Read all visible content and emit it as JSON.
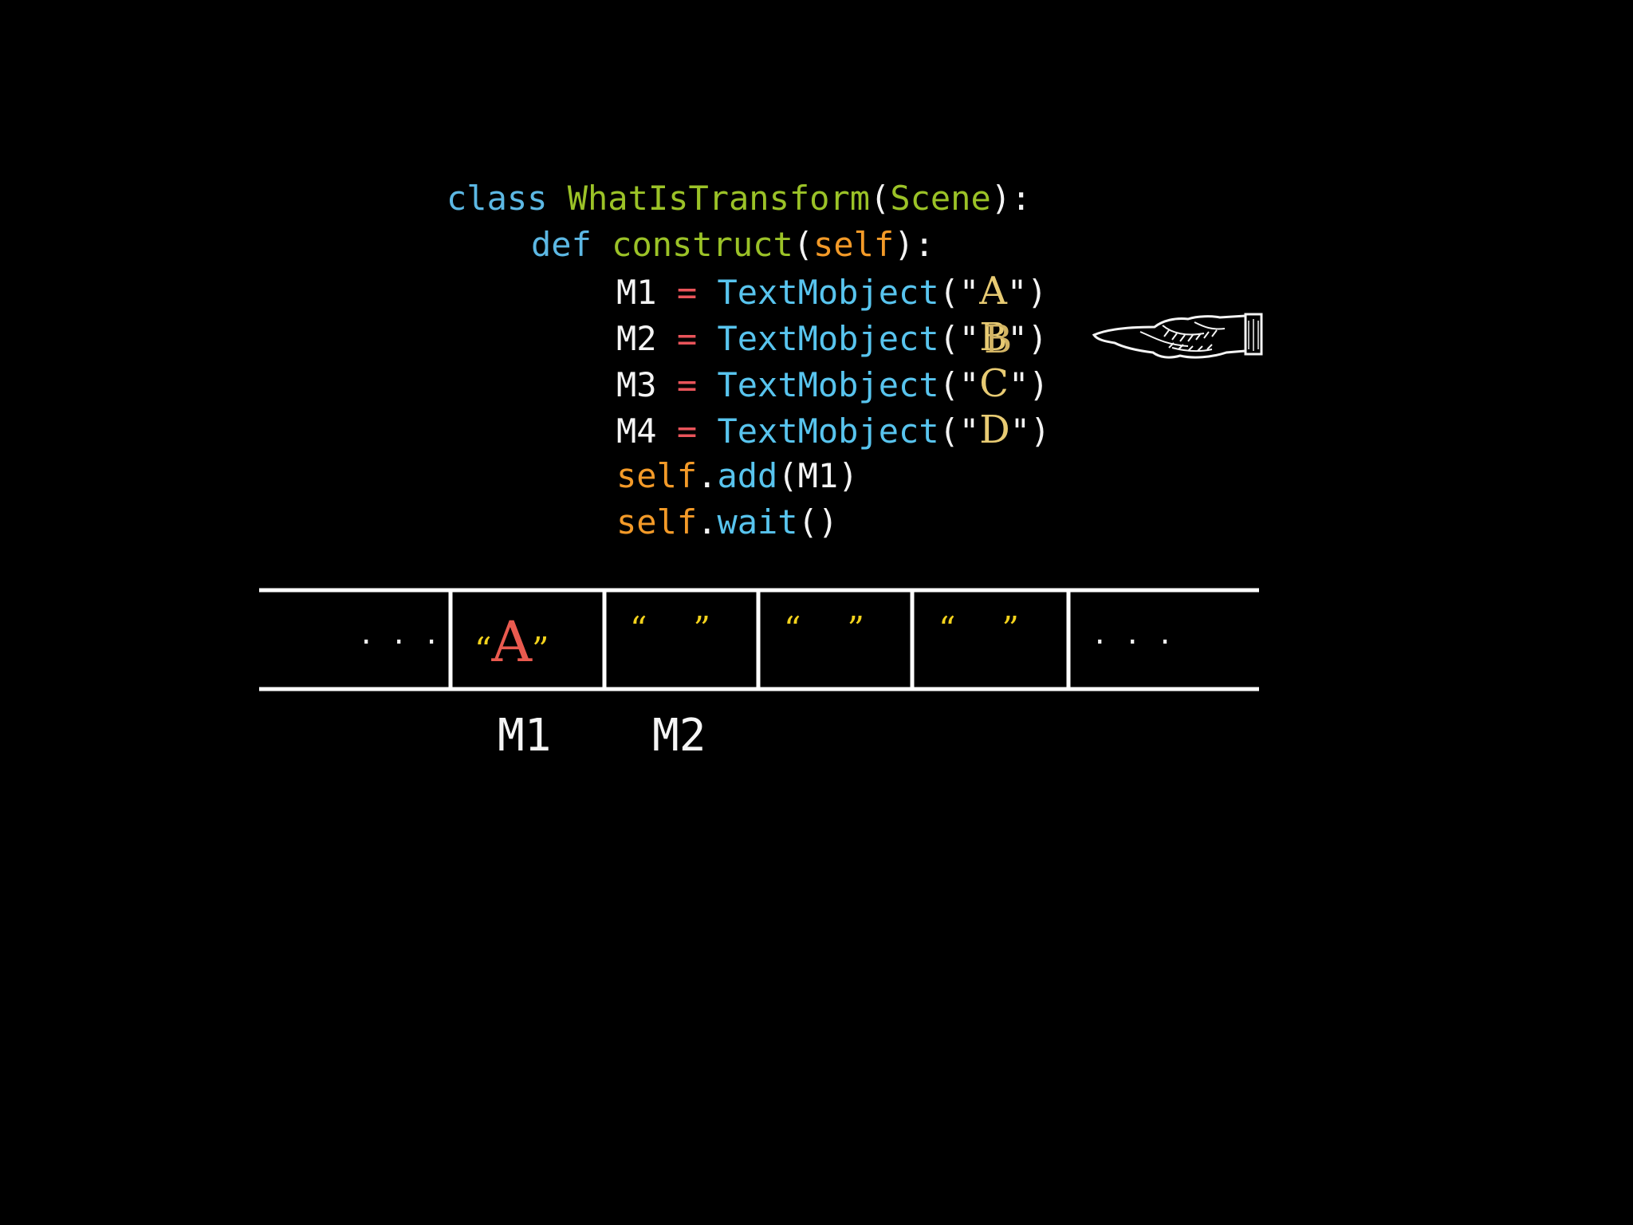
{
  "code": {
    "line1": {
      "kw": "class",
      "name": "WhatIsTransform",
      "open": "(",
      "base": "Scene",
      "close": "):"
    },
    "line2": {
      "kw": "def",
      "name": "construct",
      "open": "(",
      "arg": "self",
      "close": "):"
    },
    "assignments": [
      {
        "var": "M1",
        "op": "=",
        "func": "TextMobject",
        "open": "(\"",
        "value": "A",
        "close": "\")"
      },
      {
        "var": "M2",
        "op": "=",
        "func": "TextMobject",
        "open": "(\"",
        "value": "B",
        "close": "\")"
      },
      {
        "var": "M3",
        "op": "=",
        "func": "TextMobject",
        "open": "(\"",
        "value": "C",
        "close": "\")"
      },
      {
        "var": "M4",
        "op": "=",
        "func": "TextMobject",
        "open": "(\"",
        "value": "D",
        "close": "\")"
      }
    ],
    "line7": {
      "self": "self",
      "dot": ".",
      "method": "add",
      "args": "(M1)"
    },
    "line8": {
      "self": "self",
      "dot": ".",
      "method": "wait",
      "args": "()"
    },
    "ghost_letter": "B"
  },
  "memory": {
    "left_ellipsis": ". . .",
    "right_ellipsis": ". . .",
    "cells": [
      {
        "open": "“",
        "value": "A",
        "close": "”"
      },
      {
        "open": "“",
        "value": "",
        "close": "”"
      },
      {
        "open": "“",
        "value": "",
        "close": "”"
      },
      {
        "open": "“",
        "value": "",
        "close": "”"
      }
    ],
    "labels": [
      "M1",
      "M2"
    ]
  },
  "colors": {
    "keyword": "#5cb8e4",
    "class_name": "#9bc227",
    "self": "#f39a28",
    "operator": "#e9545a",
    "function": "#58c4ee",
    "string": "#e8cb73",
    "quote_marks": "#f3d21c",
    "stored_value": "#ea5a4f"
  },
  "icons": {
    "pointer": "pointing-hand-icon"
  }
}
